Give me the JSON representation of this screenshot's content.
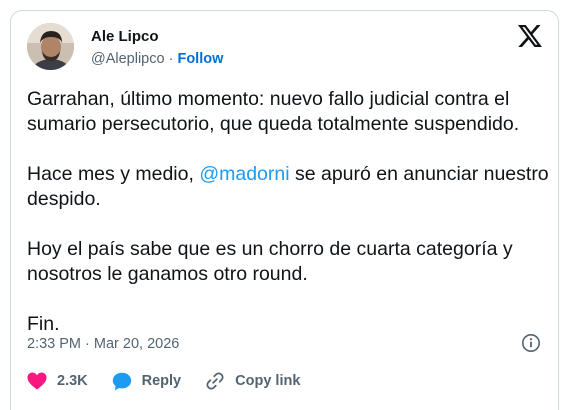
{
  "author": {
    "name": "Ale Lipco",
    "handle": "@Aleplipco",
    "separator": "·",
    "follow_label": "Follow"
  },
  "platform_icon": "x-logo-icon",
  "tweet": {
    "paragraph1": "Garrahan, último momento: nuevo fallo judicial contra el sumario persecutorio, que queda totalmente suspendido.",
    "paragraph2_before": "Hace mes y medio, ",
    "paragraph2_mention": "@madorni",
    "paragraph2_after": " se apuró en anunciar nuestro despido.",
    "paragraph3": "Hoy el país sabe que es un chorro de cuarta categoría y nosotros le ganamos otro round.",
    "paragraph4": "Fin."
  },
  "meta": {
    "time": "2:33 PM",
    "separator": "·",
    "date": "Mar 20, 2026"
  },
  "actions": {
    "likes": "2.3K",
    "reply_label": "Reply",
    "copy_link_label": "Copy link"
  },
  "colors": {
    "like": "#f91880",
    "reply": "#1d9bf0",
    "link": "#1d9bf0",
    "follow": "#006fd6",
    "muted": "#536471"
  }
}
